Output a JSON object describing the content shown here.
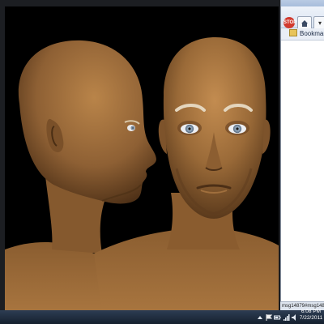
{
  "browser": {
    "stop_icon_label": "STOP",
    "bookmarks_label": "Bookmar",
    "status_text": "msg14879#msg148"
  },
  "taskbar": {
    "time": "6:08 PM",
    "date": "7/22/2011",
    "tray_icons": [
      "arrow-up-icon",
      "flag-icon",
      "battery-icon",
      "network-icon",
      "volume-icon"
    ]
  },
  "colors": {
    "skin_base": "#9a6a38",
    "skin_shadow": "#5b3a1c",
    "skin_highlight": "#c89258",
    "background": "#000000",
    "eye_iris": "#8ea3b8"
  }
}
